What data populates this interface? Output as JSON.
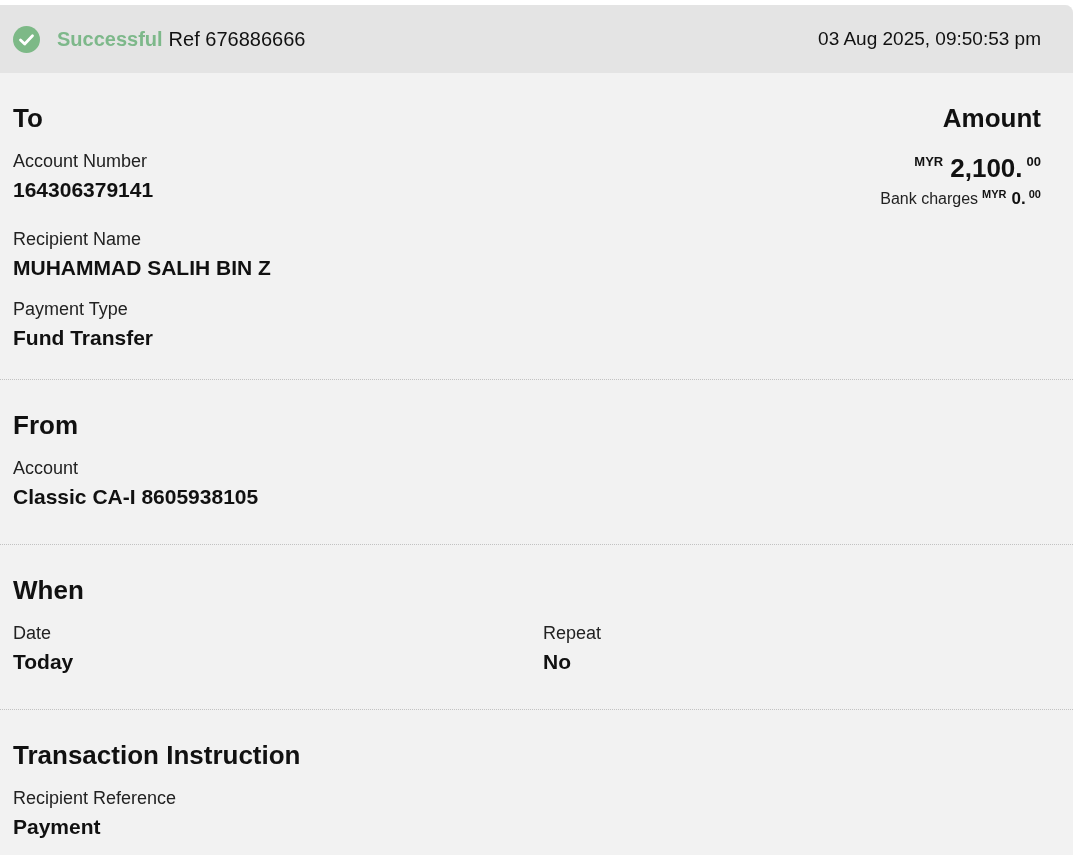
{
  "status": {
    "kind": "success",
    "label": "Successful",
    "reference": "Ref 676886666",
    "timestamp": "03 Aug 2025, 09:50:53 pm"
  },
  "sections": [
    {
      "kind": "stack",
      "title": "To",
      "fields": [
        {
          "label": "Account Number",
          "value": "164306379141"
        },
        {
          "label": "Recipient Name",
          "value": "MUHAMMAD SALIH BIN Z"
        },
        {
          "label": "Payment Type",
          "value": "Fund Transfer"
        }
      ],
      "amount": {
        "title": "Amount",
        "currency": "MYR",
        "whole": "2,100.",
        "cents": "00",
        "charges": {
          "label": "Bank charges",
          "currency": "MYR",
          "whole": "0.",
          "cents": "00"
        }
      }
    },
    {
      "kind": "stack",
      "title": "From",
      "fields": [
        {
          "label": "Account",
          "value": "Classic CA-I 8605938105"
        }
      ]
    },
    {
      "kind": "columns",
      "title": "When",
      "fields": [
        {
          "label": "Date",
          "value": "Today"
        },
        {
          "label": "Repeat",
          "value": "No"
        }
      ]
    },
    {
      "kind": "stack",
      "title": "Transaction Instruction",
      "fields": [
        {
          "label": "Recipient Reference",
          "value": "Payment"
        }
      ]
    }
  ]
}
